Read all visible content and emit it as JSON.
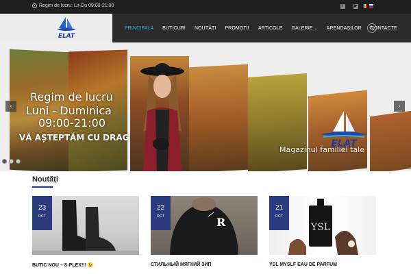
{
  "topbar": {
    "hours": "Regim de lucru: Ln-Du 09:00-21:00",
    "socials": [
      "facebook-icon",
      "youtube-icon"
    ],
    "languages": [
      "ro-flag-icon",
      "ru-flag-icon"
    ]
  },
  "nav": {
    "items": [
      {
        "label": "PRINCIPALA",
        "active": true
      },
      {
        "label": "BUTICURI"
      },
      {
        "label": "NOUTĂȚI"
      },
      {
        "label": "PROMOȚII"
      },
      {
        "label": "ARTICOLE"
      },
      {
        "label": "GALERIE",
        "dropdown": true
      },
      {
        "label": "ARENDAȘILOR"
      },
      {
        "label": "CONTACTE"
      }
    ],
    "accent": "#2ab3e3"
  },
  "hero": {
    "line1": "Regim de lucru",
    "line2": "Luni - Duminica",
    "line3": "09:00-21:00",
    "line4": "VĂ AȘTEPTĂM CU DRAG",
    "tagline": "Magazinul familiei tale",
    "logo_text": "ELAT"
  },
  "news": {
    "heading": "Noutăți",
    "posts": [
      {
        "day": "23",
        "month": "OCT",
        "title": "BUTIC NOU – S-PLEX!!! 😉"
      },
      {
        "day": "22",
        "month": "OCT",
        "title": "СТИЛЬНЫЙ МЯГКИЙ ЗИП"
      },
      {
        "day": "21",
        "month": "OCT",
        "title": "YSL MYSLF EAU DE PARFUM"
      }
    ]
  }
}
